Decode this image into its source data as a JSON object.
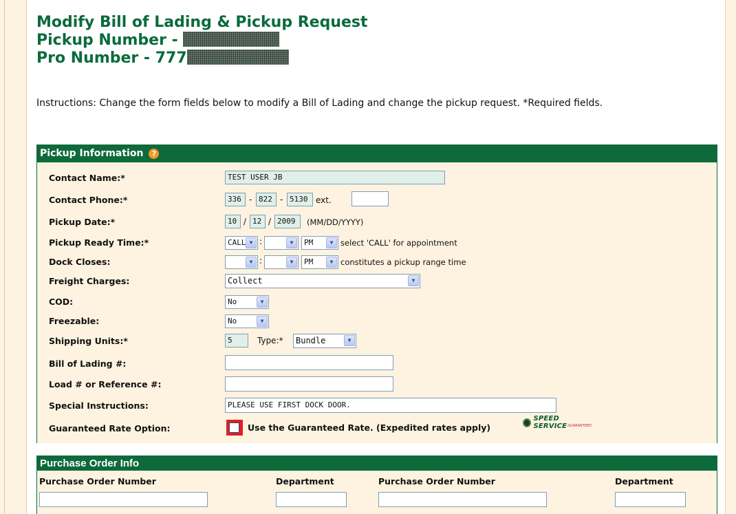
{
  "header": {
    "title": "Modify Bill of Lading & Pickup Request",
    "pickup_number_label": "Pickup Number -",
    "pro_number_label": "Pro Number - 777"
  },
  "instructions": "Instructions: Change the form fields below to modify a Bill of Lading and change the pickup request. *Required fields.",
  "pickup_section": {
    "title": "Pickup Information",
    "help_icon": "?",
    "contact_name": {
      "label": "Contact Name:*",
      "value": "TEST USER JB"
    },
    "contact_phone": {
      "label": "Contact Phone:*",
      "area": "336",
      "prefix": "822",
      "line": "5130",
      "ext_label": "ext.",
      "ext_value": ""
    },
    "pickup_date": {
      "label": "Pickup Date:*",
      "month": "10",
      "day": "12",
      "year": "2009",
      "format": "(MM/DD/YYYY)"
    },
    "ready_time": {
      "label": "Pickup Ready Time:*",
      "hour": "CALL",
      "minute": "",
      "ampm": "PM",
      "hint": "select 'CALL' for appointment"
    },
    "dock_closes": {
      "label": "Dock Closes:",
      "hour": "",
      "minute": "",
      "ampm": "PM",
      "hint": "constitutes a pickup range time"
    },
    "freight_charges": {
      "label": "Freight Charges:",
      "value": "Collect"
    },
    "cod": {
      "label": "COD:",
      "value": "No"
    },
    "freezable": {
      "label": "Freezable:",
      "value": "No"
    },
    "shipping_units": {
      "label": "Shipping Units:*",
      "value": "5",
      "type_label": "Type:*",
      "type_value": "Bundle"
    },
    "bol": {
      "label": "Bill of Lading #:",
      "value": ""
    },
    "load_ref": {
      "label": "Load # or Reference #:",
      "value": ""
    },
    "special": {
      "label": "Special Instructions:",
      "value": "PLEASE USE FIRST DOCK DOOR."
    },
    "guaranteed": {
      "label": "Guaranteed Rate Option:",
      "text": "Use the Guaranteed Rate. (Expedited rates apply)",
      "logo_text": "SPEED SERVICE",
      "logo_tag": "GUARANTEED"
    }
  },
  "po_section": {
    "title": "Purchase Order Info",
    "columns": [
      "Purchase Order Number",
      "Department",
      "Purchase Order Number",
      "Department"
    ]
  },
  "colors": {
    "brand_green": "#0e6a3b",
    "title_green": "#0a6b3c",
    "form_bg": "#fdf3e0",
    "accent_orange": "#f0982a",
    "highlight_red": "#e21e26"
  }
}
